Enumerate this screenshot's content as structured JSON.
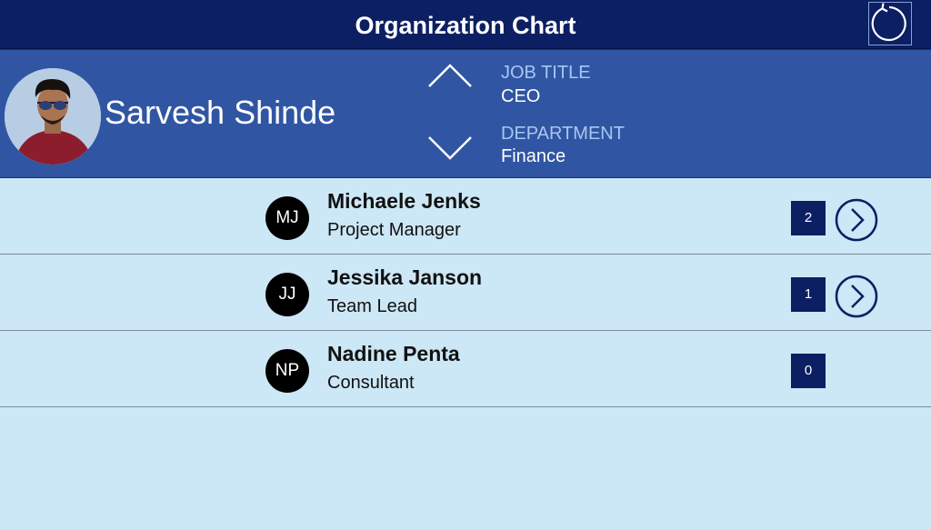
{
  "header": {
    "title": "Organization Chart",
    "refresh_icon": "refresh-icon"
  },
  "profile": {
    "name": "Sarvesh Shinde",
    "job_title_label": "JOB TITLE",
    "job_title": "CEO",
    "department_label": "DEPARTMENT",
    "department": "Finance"
  },
  "reports": [
    {
      "initials": "MJ",
      "name": "Michaele Jenks",
      "title": "Project Manager",
      "count": "2",
      "has_reports": true
    },
    {
      "initials": "JJ",
      "name": "Jessika Janson",
      "title": "Team Lead",
      "count": "1",
      "has_reports": true
    },
    {
      "initials": "NP",
      "name": "Nadine Penta",
      "title": "Consultant",
      "count": "0",
      "has_reports": false
    }
  ],
  "colors": {
    "header_bg": "#0c1f63",
    "profile_bg": "#3055a3",
    "list_bg": "#cce7f5",
    "label_color": "#a9c6f2",
    "badge_bg": "#0c1f63"
  }
}
